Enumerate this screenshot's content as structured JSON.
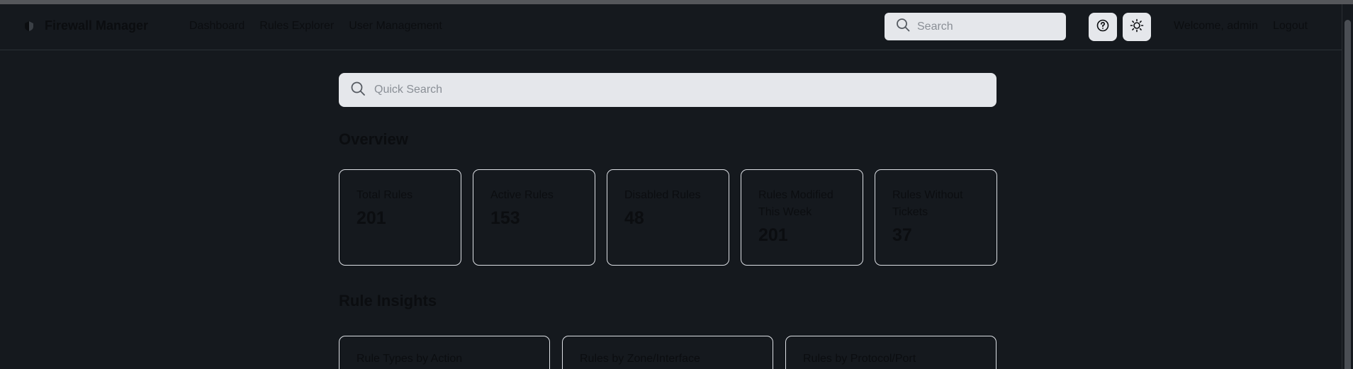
{
  "brand": {
    "name": "Firewall Manager",
    "icon": "shield-icon"
  },
  "nav": {
    "links": [
      {
        "label": "Dashboard"
      },
      {
        "label": "Rules Explorer"
      },
      {
        "label": "User Management"
      }
    ]
  },
  "header": {
    "search_placeholder": "Search",
    "help_icon": "help-circle-icon",
    "theme_icon": "sun-icon",
    "welcome": "Welcome, admin",
    "logout": "Logout"
  },
  "quick_search": {
    "placeholder": "Quick Search"
  },
  "overview": {
    "title": "Overview",
    "cards": [
      {
        "label": "Total Rules",
        "value": "201"
      },
      {
        "label": "Active Rules",
        "value": "153"
      },
      {
        "label": "Disabled Rules",
        "value": "48"
      },
      {
        "label": "Rules Modified This Week",
        "value": "201"
      },
      {
        "label": "Rules Without Tickets",
        "value": "37"
      }
    ]
  },
  "insights": {
    "title": "Rule Insights",
    "cards": [
      {
        "title": "Rule Types by Action"
      },
      {
        "title": "Rules by Zone/Interface"
      },
      {
        "title": "Rules by Protocol/Port"
      }
    ]
  },
  "colors": {
    "background": "#15191e",
    "text": "#0b0d10",
    "input_bg": "#e5e7eb",
    "card_border": "#dcdfe4"
  }
}
